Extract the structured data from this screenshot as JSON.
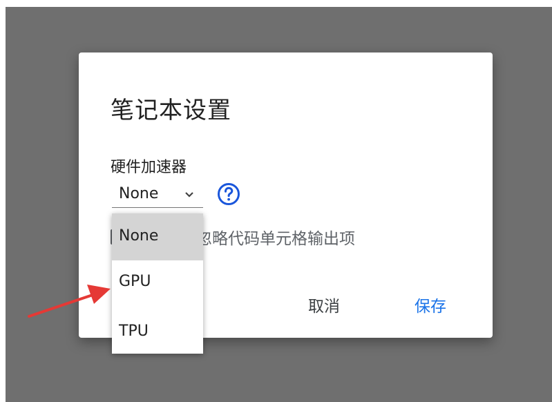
{
  "dialog": {
    "title": "笔记本设置",
    "hardware_label": "硬件加速器",
    "selected_value": "None",
    "checkbox_label": "笔记本时忽略代码单元格输出项",
    "cancel_label": "取消",
    "save_label": "保存"
  },
  "dropdown": {
    "options": [
      "None",
      "GPU",
      "TPU"
    ],
    "selected": "None"
  },
  "colors": {
    "overlay": "#6f6f6f",
    "accent": "#1a73e8",
    "arrow": "#e53935",
    "selected_option_bg": "#d4d4d4"
  },
  "icons": {
    "help": "help-circle-icon",
    "chevron": "chevron-down-icon"
  }
}
